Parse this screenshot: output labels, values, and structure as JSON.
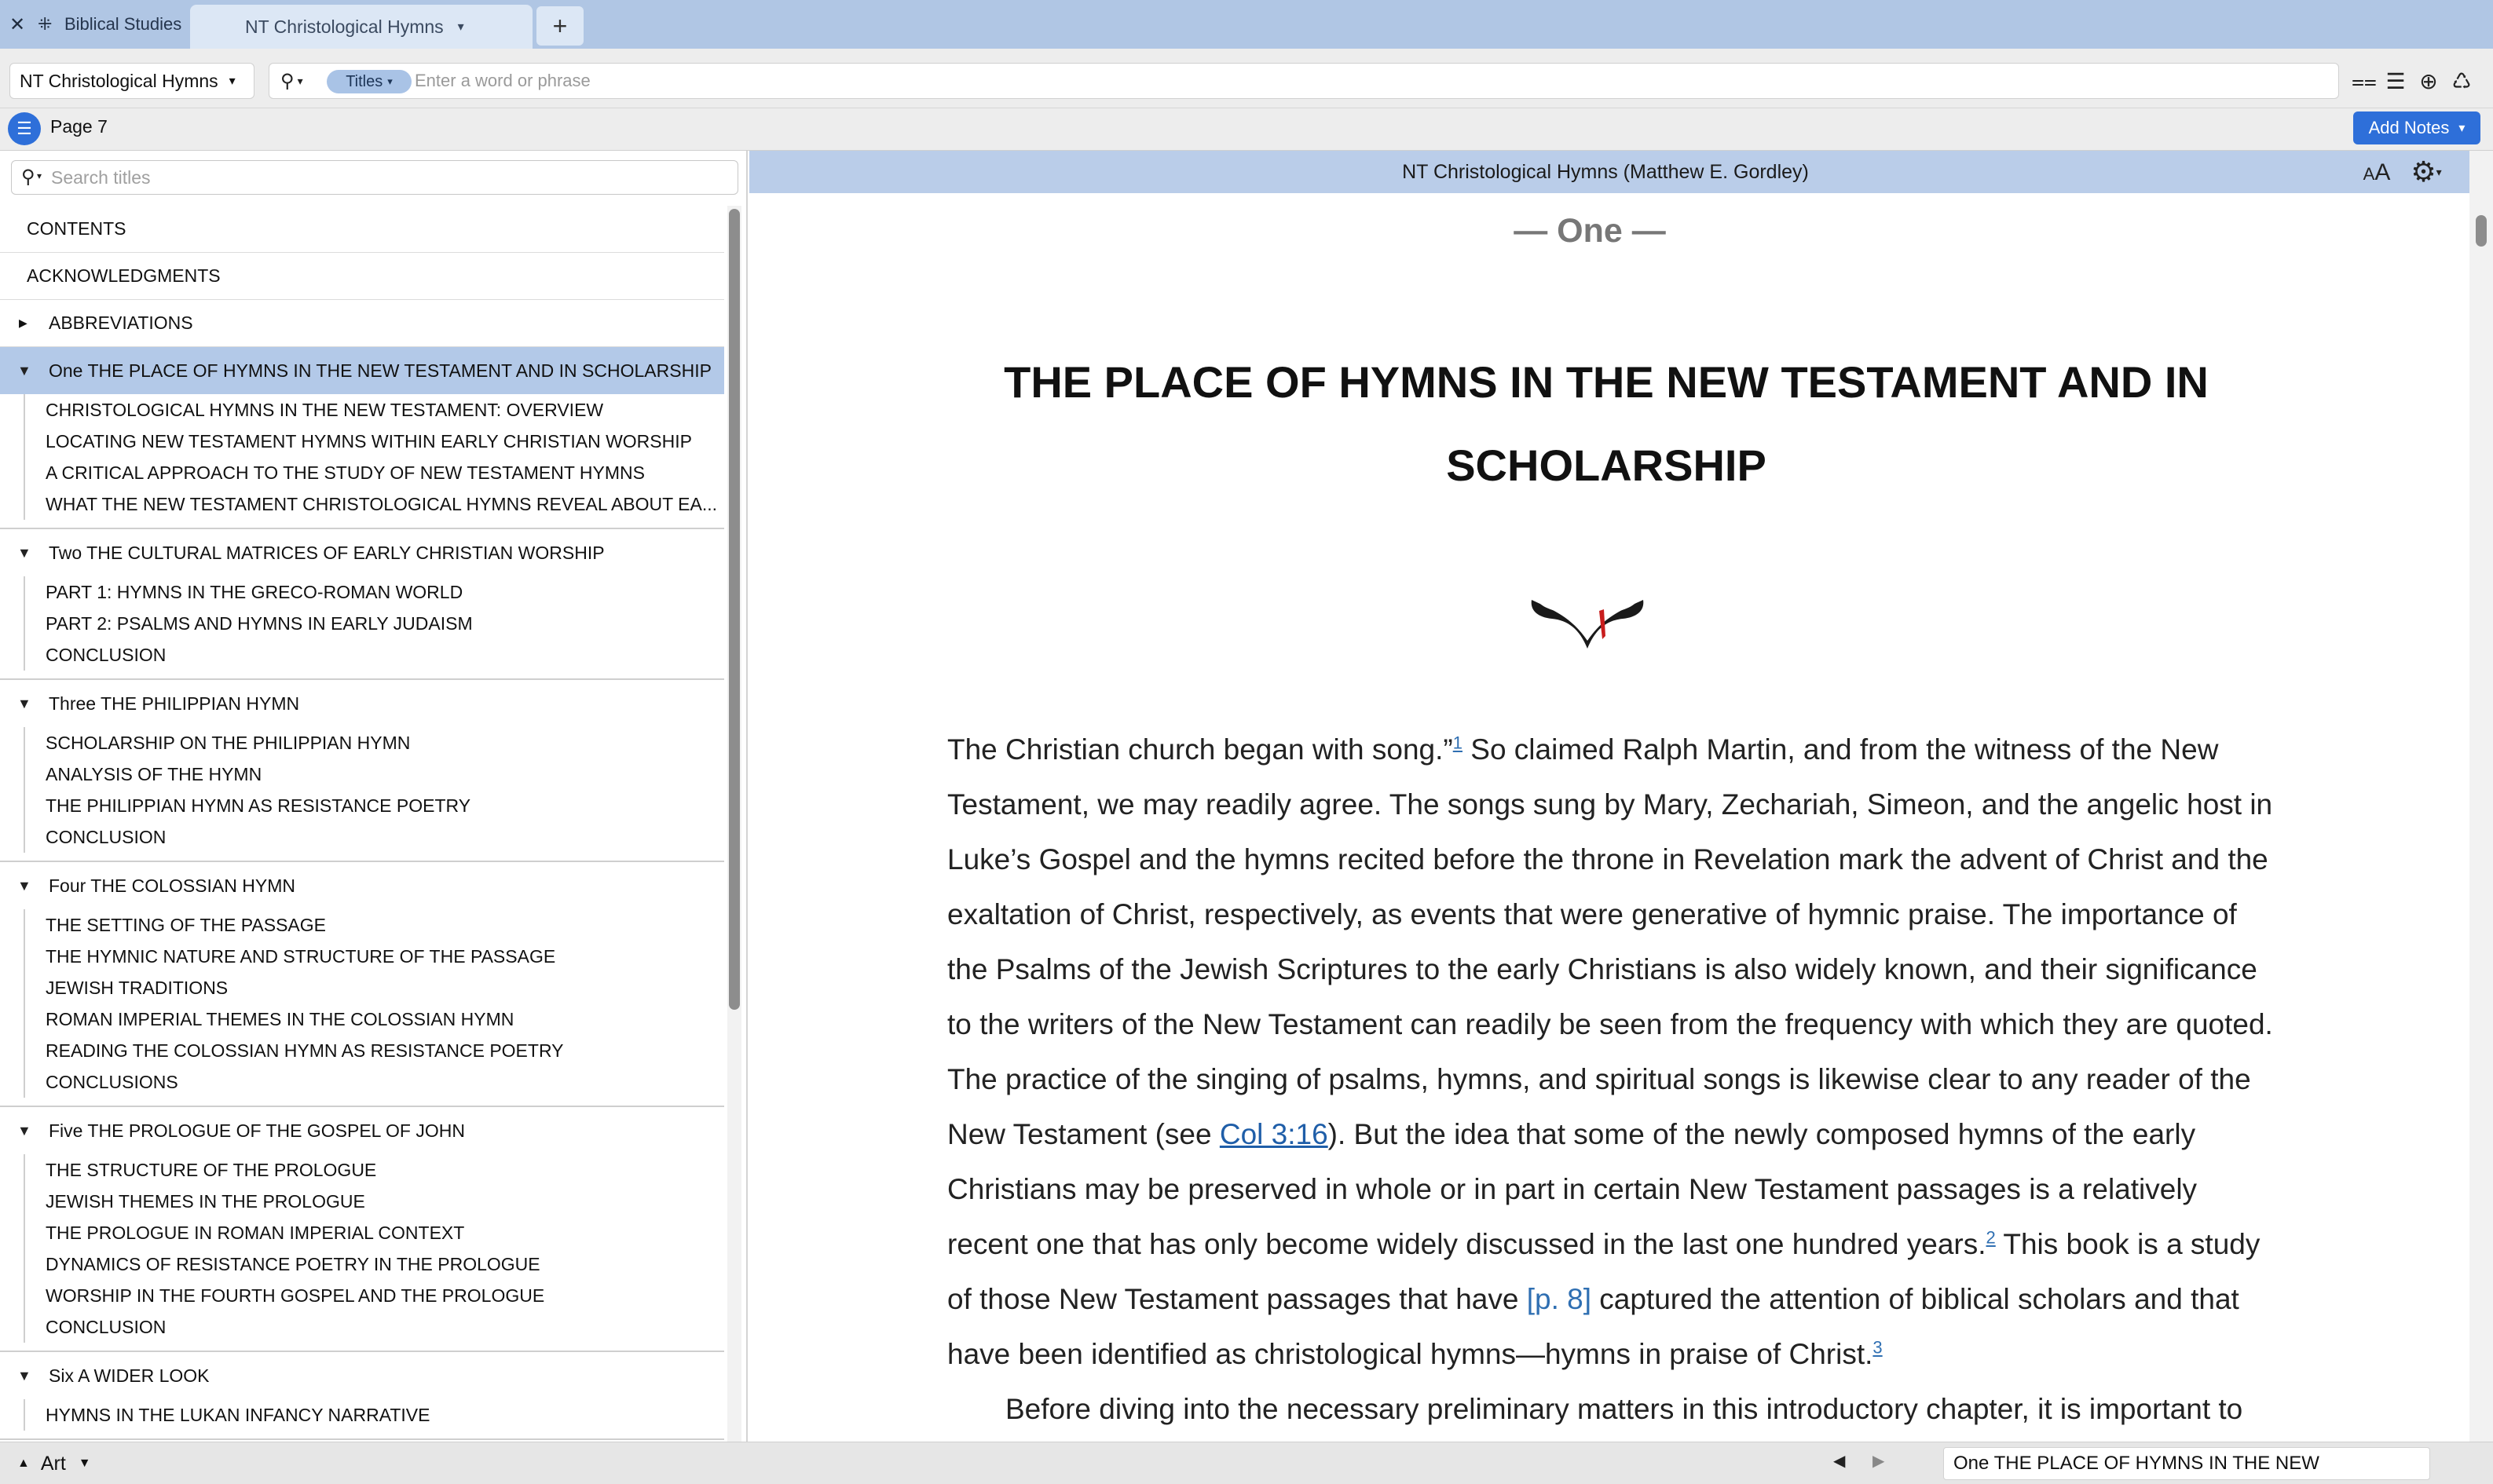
{
  "window": {
    "close_glyph": "✕",
    "library_label": "Biblical Studies",
    "active_tab": "NT Christological Hymns",
    "add_tab_glyph": "+"
  },
  "search": {
    "resource": "NT Christological Hymns",
    "scope": "Titles",
    "placeholder": "Enter a word or phrase"
  },
  "toolbar_icons": [
    "parallel-icon",
    "panel-menu-icon",
    "add-circle-icon",
    "share-icon"
  ],
  "page": {
    "label": "Page 7",
    "add_notes": "Add Notes"
  },
  "sidebar": {
    "search_placeholder": "Search titles",
    "top_items": [
      {
        "label": "CONTENTS",
        "expandable": false
      },
      {
        "label": "ACKNOWLEDGMENTS",
        "expandable": false
      },
      {
        "label": "ABBREVIATIONS",
        "expandable": true
      }
    ],
    "chapters": [
      {
        "label": "One THE PLACE OF HYMNS IN THE NEW TESTAMENT AND IN SCHOLARSHIP",
        "selected": true,
        "items": [
          "CHRISTOLOGICAL HYMNS IN THE NEW TESTAMENT: OVERVIEW",
          "LOCATING NEW TESTAMENT HYMNS WITHIN EARLY CHRISTIAN WORSHIP",
          "A CRITICAL APPROACH TO THE STUDY OF NEW TESTAMENT HYMNS",
          "WHAT THE NEW TESTAMENT CHRISTOLOGICAL HYMNS REVEAL ABOUT EA..."
        ]
      },
      {
        "label": "Two THE CULTURAL MATRICES OF EARLY CHRISTIAN WORSHIP",
        "selected": false,
        "items": [
          "PART 1: HYMNS IN THE GRECO-ROMAN WORLD",
          "PART 2: PSALMS AND HYMNS IN EARLY JUDAISM",
          "CONCLUSION"
        ]
      },
      {
        "label": "Three THE PHILIPPIAN HYMN",
        "selected": false,
        "items": [
          "SCHOLARSHIP ON THE PHILIPPIAN HYMN",
          "ANALYSIS OF THE HYMN",
          "THE PHILIPPIAN HYMN AS RESISTANCE POETRY",
          "CONCLUSION"
        ]
      },
      {
        "label": "Four THE COLOSSIAN HYMN",
        "selected": false,
        "items": [
          "THE SETTING OF THE PASSAGE",
          "THE HYMNIC NATURE AND STRUCTURE OF THE PASSAGE",
          "JEWISH TRADITIONS",
          "ROMAN IMPERIAL THEMES IN THE COLOSSIAN HYMN",
          "READING THE COLOSSIAN HYMN AS RESISTANCE POETRY",
          "CONCLUSIONS"
        ]
      },
      {
        "label": "Five THE PROLOGUE OF THE GOSPEL OF JOHN",
        "selected": false,
        "items": [
          "THE STRUCTURE OF THE PROLOGUE",
          "JEWISH THEMES IN THE PROLOGUE",
          "THE PROLOGUE IN ROMAN IMPERIAL CONTEXT",
          "DYNAMICS OF RESISTANCE POETRY IN THE PROLOGUE",
          "WORSHIP IN THE FOURTH GOSPEL AND THE PROLOGUE",
          "CONCLUSION"
        ]
      },
      {
        "label": "Six A WIDER LOOK",
        "selected": false,
        "items": [
          "HYMNS IN THE LUKAN INFANCY NARRATIVE"
        ]
      }
    ]
  },
  "reader": {
    "header_title": "NT Christological Hymns (Matthew E. Gordley)",
    "font_button": "AA",
    "chapter_number": "— One —",
    "chapter_title": "THE PLACE OF HYMNS IN THE NEW TESTAMENT AND IN SCHOLARSHIP",
    "p1": {
      "a": "The Christian church began with song.”",
      "fn1": "1",
      "b": " So claimed Ralph Martin, and from the witness of the New Testament, we may readily agree. The songs sung by Mary, Zechariah, Simeon, and the angelic host in Luke’s Gospel and the hymns recited before the throne in Revelation mark the advent of Christ and the exaltation of Christ, respectively, as events that were generative of hymnic praise. The importance of the Psalms of the Jewish Scriptures to the early Christians is also widely known, and their significance to the writers of the New Testament can readily be seen from the frequency with which they are quoted. The practice of the singing of psalms, hymns, and spiritual songs is likewise clear to any reader of the New Testament (see ",
      "xref": "Col 3:16",
      "c": "). But the idea that some of the newly composed hymns of the early Christians may be preserved in whole or in part in certain New Testament passages is a relatively recent one that has only become widely discussed in the last one hundred years.",
      "fn2": "2",
      "d": " This book is a study of those New Testament passages that have ",
      "page_marker": "[p. 8]",
      "e": " captured the attention of biblical scholars and that have been identified as christological hymns—hymns in praise of Christ.",
      "fn3": "3"
    },
    "p2": "Before diving into the necessary preliminary matters in this introductory chapter, it is important to"
  },
  "bottom": {
    "panel_menu": "Art",
    "location": "One THE PLACE OF HYMNS IN THE NEW"
  }
}
